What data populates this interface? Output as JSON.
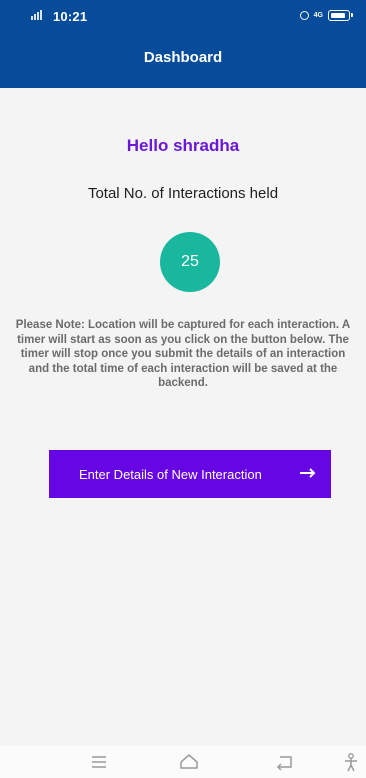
{
  "status_bar": {
    "time": "10:21",
    "icons": [
      "signal-icon",
      "alarm-icon",
      "network-4g-icon",
      "battery-icon"
    ],
    "network": "4G"
  },
  "app_bar": {
    "title": "Dashboard",
    "color": "#064c9b"
  },
  "main": {
    "greeting": "Hello shradha",
    "greeting_color": "#6a18d6",
    "interactions_label": "Total No. of Interactions held",
    "interaction_count": "25",
    "count_color": "#19b79d",
    "note": "Please Note: Location will be captured for each interaction. A timer will start as soon as you click on the button below. The timer will stop once you submit the details of an interaction and the total time of each interaction will be saved at the backend.",
    "cta_label": "Enter Details of New Interaction",
    "cta_icon": "arrow-right-icon",
    "cta_color": "#6607e3"
  },
  "nav_bar": {
    "buttons": [
      "menu-icon",
      "home-icon",
      "back-icon",
      "assistant-icon"
    ]
  }
}
